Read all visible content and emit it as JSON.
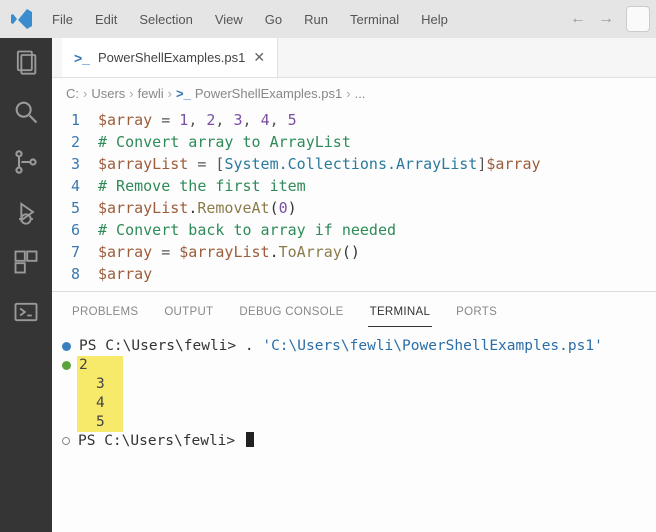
{
  "menu": {
    "items": [
      "File",
      "Edit",
      "Selection",
      "View",
      "Go",
      "Run",
      "Terminal",
      "Help"
    ]
  },
  "tab": {
    "filename": "PowerShellExamples.ps1"
  },
  "breadcrumb": {
    "parts": [
      "C:",
      "Users",
      "fewli"
    ],
    "file": "PowerShellExamples.ps1",
    "tail": "..."
  },
  "code": {
    "lines": [
      {
        "n": "1",
        "seg": [
          [
            "var",
            "$array"
          ],
          [
            "op",
            " = "
          ],
          [
            "num",
            "1"
          ],
          [
            "op",
            ", "
          ],
          [
            "num",
            "2"
          ],
          [
            "op",
            ", "
          ],
          [
            "num",
            "3"
          ],
          [
            "op",
            ", "
          ],
          [
            "num",
            "4"
          ],
          [
            "op",
            ", "
          ],
          [
            "num",
            "5"
          ]
        ]
      },
      {
        "n": "2",
        "seg": [
          [
            "cmt",
            "# Convert array to ArrayList"
          ]
        ]
      },
      {
        "n": "3",
        "seg": [
          [
            "var",
            "$arrayList"
          ],
          [
            "op",
            " = ["
          ],
          [
            "type",
            "System.Collections.ArrayList"
          ],
          [
            "op",
            "]"
          ],
          [
            "var",
            "$array"
          ]
        ]
      },
      {
        "n": "4",
        "seg": [
          [
            "cmt",
            "# Remove the first item"
          ]
        ]
      },
      {
        "n": "5",
        "seg": [
          [
            "var",
            "$arrayList"
          ],
          [
            "plain",
            "."
          ],
          [
            "mth",
            "RemoveAt"
          ],
          [
            "plain",
            "("
          ],
          [
            "num",
            "0"
          ],
          [
            "plain",
            ")"
          ]
        ]
      },
      {
        "n": "6",
        "seg": [
          [
            "cmt",
            "# Convert back to array if needed"
          ]
        ]
      },
      {
        "n": "7",
        "seg": [
          [
            "var",
            "$array"
          ],
          [
            "op",
            " = "
          ],
          [
            "var",
            "$arrayList"
          ],
          [
            "plain",
            "."
          ],
          [
            "mth",
            "ToArray"
          ],
          [
            "plain",
            "()"
          ]
        ]
      },
      {
        "n": "8",
        "seg": [
          [
            "var",
            "$array"
          ]
        ]
      }
    ]
  },
  "panel": {
    "tabs": [
      "PROBLEMS",
      "OUTPUT",
      "DEBUG CONSOLE",
      "TERMINAL",
      "PORTS"
    ],
    "active": 3
  },
  "terminal": {
    "prompt1_prefix": "PS C:\\Users\\fewli> ",
    "prompt1_cmd": ". ",
    "prompt1_str": "'C:\\Users\\fewli\\PowerShellExamples.ps1'",
    "output": [
      "2",
      "3",
      "4",
      "5"
    ],
    "prompt2_prefix": "PS C:\\Users\\fewli> "
  }
}
